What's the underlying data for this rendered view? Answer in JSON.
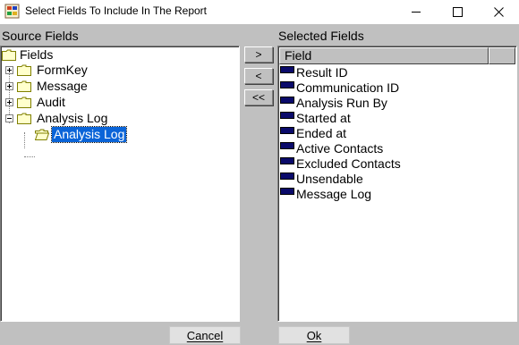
{
  "window": {
    "title": "Select Fields To Include In The Report",
    "app_icon": "report-icon",
    "minimize_icon": "minimize-icon",
    "maximize_icon": "maximize-icon",
    "close_icon": "close-icon"
  },
  "source": {
    "label": "Source Fields",
    "tree": [
      {
        "label": "Fields",
        "level": 0,
        "expander": "none",
        "icon": "folder-icon"
      },
      {
        "label": "FormKey",
        "level": 1,
        "expander": "plus",
        "icon": "folder-icon"
      },
      {
        "label": "Message",
        "level": 1,
        "expander": "plus",
        "icon": "folder-icon"
      },
      {
        "label": "Audit",
        "level": 1,
        "expander": "plus",
        "icon": "folder-icon"
      },
      {
        "label": "Analysis Log",
        "level": 1,
        "expander": "minus",
        "icon": "folder-icon"
      },
      {
        "label": "Analysis Log",
        "level": 2,
        "expander": "none",
        "icon": "open-folder-icon",
        "selected": true
      }
    ]
  },
  "move_buttons": {
    "add": ">",
    "remove": "<",
    "remove_all": "<<"
  },
  "selected": {
    "label": "Selected Fields",
    "column_header": "Field",
    "items": [
      "Result ID",
      "Communication ID",
      "Analysis Run By",
      "Started at",
      "Ended at",
      "Active Contacts",
      "Excluded Contacts",
      "Unsendable",
      "Message Log"
    ]
  },
  "footer": {
    "cancel": "Cancel",
    "ok": "Ok"
  },
  "colors": {
    "selection": "#0a64d8",
    "swatch": "#0a0a6a",
    "dialog_bg": "#c0c0c0"
  }
}
